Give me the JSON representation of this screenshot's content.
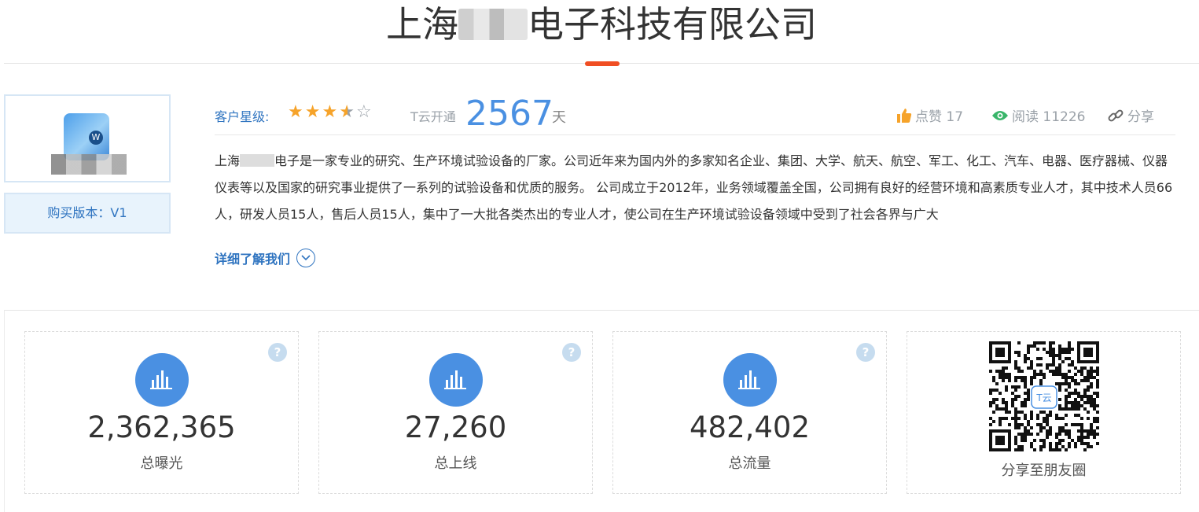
{
  "header": {
    "title_prefix": "上海",
    "title_suffix": "电子科技有限公司"
  },
  "sidebar": {
    "version_label": "购买版本：V1"
  },
  "info": {
    "star_label": "客户星级:",
    "rating": 3.5,
    "rating_max": 5,
    "tyun_label": "T云开通",
    "tyun_days": "2567",
    "tyun_unit": "天",
    "likes_label": "点赞 17",
    "reads_label": "阅读 11226",
    "share_label": "分享",
    "colors": {
      "accent": "#f04e23",
      "blue": "#4a90e2",
      "link": "#2f74c0",
      "star": "#f6a32a"
    }
  },
  "description": {
    "p1": "上海",
    "p2": "电子是一家专业的研究、生产环境试验设备的厂家。公司近年来为国内外的多家知名企业、集团、大学、航天、航空、军工、化工、汽车、电器、医疗器械、仪器仪表等以及国家的研究事业提供了一系列的试验设备和优质的服务。 公司成立于2012年，业务领域覆盖全国，公司拥有良好的经营环境和高素质专业人才，其中技术人员66人，研发人员15人，售后人员15人，集中了一大批各类杰出的专业人才，使公司在生产环境试验设备领域中受到了社会各界与广大"
  },
  "more_label": "详细了解我们",
  "stats": [
    {
      "value": "2,362,365",
      "label": "总曝光",
      "help": "?"
    },
    {
      "value": "27,260",
      "label": "总上线",
      "help": "?"
    },
    {
      "value": "482,402",
      "label": "总流量",
      "help": "?"
    }
  ],
  "qr": {
    "caption": "分享至朋友圈",
    "center_text": "T云"
  }
}
